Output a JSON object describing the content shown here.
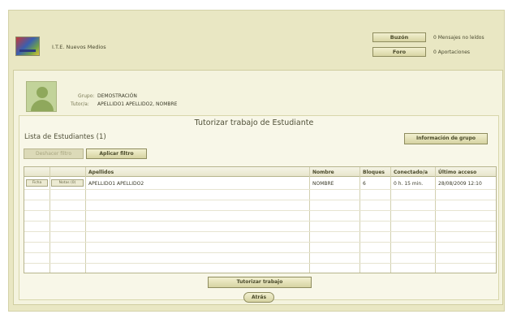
{
  "header": {
    "org_title": "I.T.E. Nuevos Medios",
    "buzon_label": "Buzón",
    "foro_label": "Foro",
    "mensajes_text": "0 Mensajes no leídos",
    "aportaciones_text": "0 Aportaciones"
  },
  "profile": {
    "grupo_label": "Grupo:",
    "grupo_value": "DEMOSTRACIÓN",
    "tutor_label": "Tutor/a:",
    "tutor_value": "APELLIDO1 APELLIDO2, NOMBRE"
  },
  "section": {
    "title": "Tutorizar trabajo de Estudiante",
    "list_title": "Lista de Estudiantes  (1)",
    "info_button": "Información de grupo",
    "disabled_button": "Deshacer filtro",
    "filter_button": "Aplicar filtro"
  },
  "table": {
    "headers": [
      "Apellidos",
      "Nombre",
      "Bloques",
      "Conectado/a",
      "Último acceso"
    ],
    "row": {
      "btn1": "Ficha",
      "btn2": "Notas (0)",
      "apellidos": "APELLIDO1 APELLIDO2",
      "nombre": "NOMBRE",
      "bloques": "6",
      "conectado": "0 h. 15 min.",
      "ultimo": "28/08/2009 12:10"
    }
  },
  "footer": {
    "tutorizar_button": "Tutorizar trabajo",
    "atras_button": "Atrás"
  }
}
